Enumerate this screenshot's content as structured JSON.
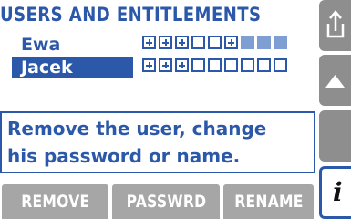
{
  "screen": {
    "title": "USERS AND ENTITLEMENTS",
    "users": [
      {
        "name": "Ewa",
        "selected": false,
        "entitlements": [
          "plus",
          "plus",
          "plus",
          "empty",
          "empty",
          "plus",
          "fill",
          "fill",
          "fill"
        ]
      },
      {
        "name": "Jacek",
        "selected": true,
        "entitlements": [
          "plus",
          "plus",
          "plus",
          "empty",
          "empty",
          "empty",
          "empty",
          "empty",
          "empty"
        ]
      }
    ],
    "message": {
      "line1": "Remove the user, change",
      "line2": "his password or name."
    },
    "softkeys": [
      {
        "label": "REMOVE"
      },
      {
        "label": "PASSWRD"
      },
      {
        "label": "RENAME"
      }
    ],
    "side_buttons": [
      {
        "icon": "export-up-icon"
      },
      {
        "icon": "triangle-up-icon"
      },
      {
        "icon": "blank-icon"
      },
      {
        "icon": "info-icon",
        "glyph": "i"
      }
    ],
    "colors": {
      "accent": "#2b58a8",
      "selection_bg": "#2b58a8",
      "softkey_bg": "#a6a6a6",
      "side_button_bg": "#8e8e8e",
      "fill_box": "#7f9fd2"
    }
  }
}
